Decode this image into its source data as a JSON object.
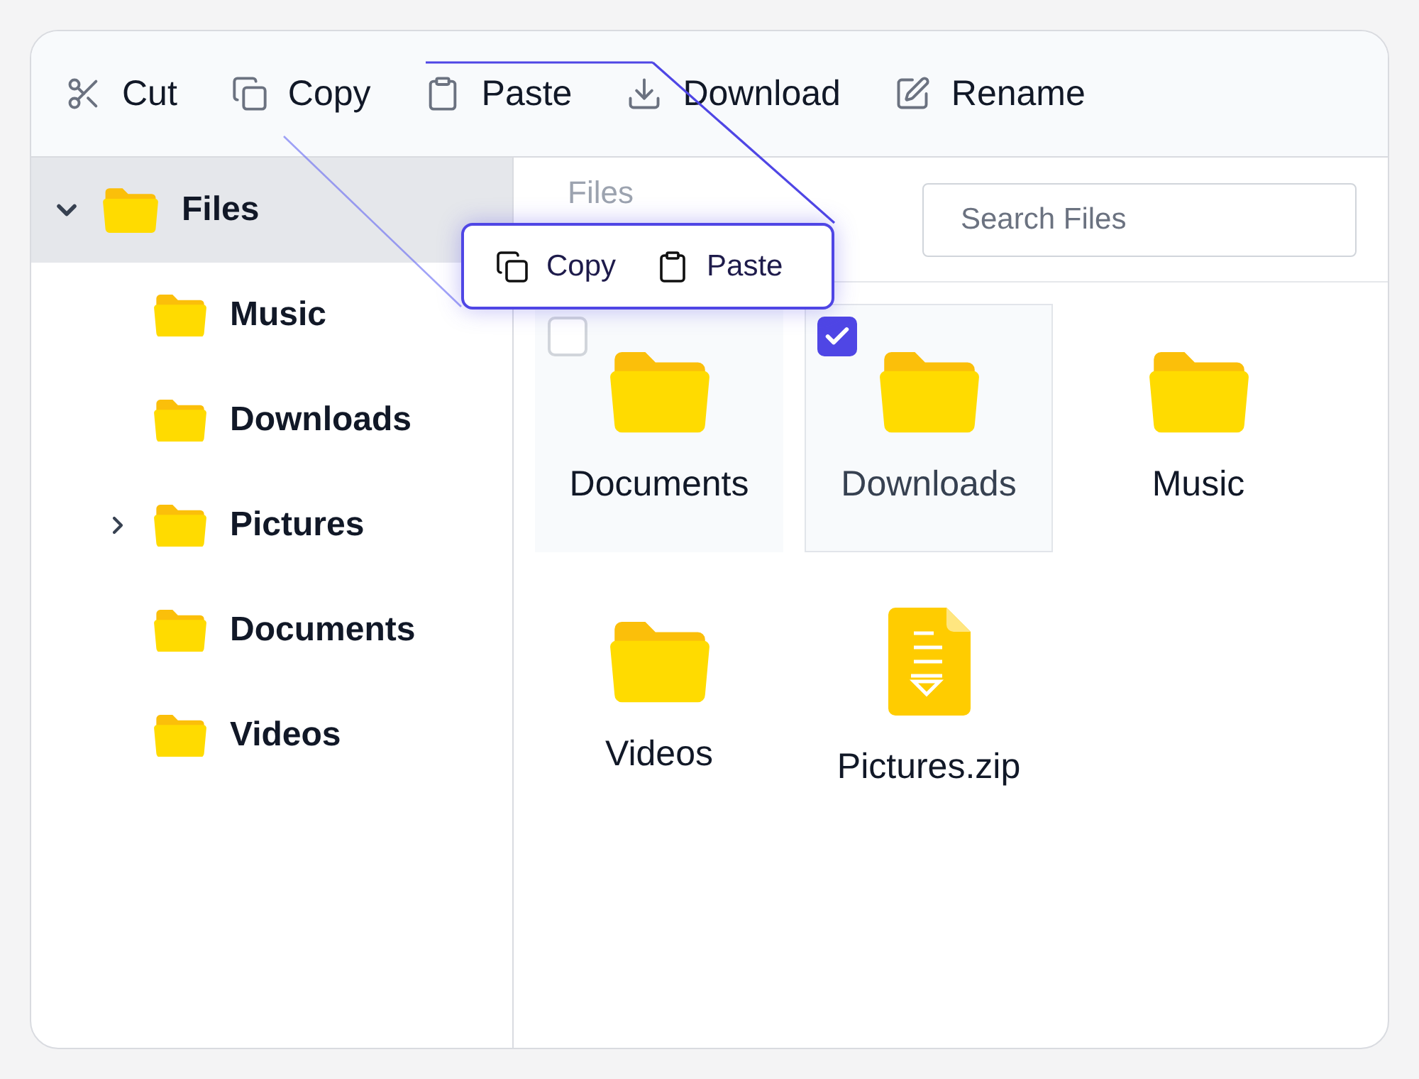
{
  "toolbar": [
    {
      "kind": "cut",
      "label": "Cut"
    },
    {
      "kind": "copy",
      "label": "Copy"
    },
    {
      "kind": "paste",
      "label": "Paste"
    },
    {
      "kind": "download",
      "label": "Download"
    },
    {
      "kind": "rename",
      "label": "Rename"
    }
  ],
  "sidebar": {
    "items": [
      {
        "label": "Files",
        "expanded": true,
        "selected": true,
        "children": [
          {
            "label": "Music",
            "selected": false
          },
          {
            "label": "Downloads",
            "selected": false
          },
          {
            "label": "Pictures",
            "expanded": false,
            "selected": false
          },
          {
            "label": "Documents",
            "selected": false
          },
          {
            "label": "Videos",
            "selected": false
          }
        ]
      }
    ]
  },
  "breadcrumb": "Files",
  "search": {
    "placeholder": "Search Files"
  },
  "popup": [
    {
      "kind": "copy",
      "label": "Copy"
    },
    {
      "kind": "paste",
      "label": "Paste"
    }
  ],
  "items": [
    {
      "kind": "folder",
      "label": "Documents",
      "hovered": true,
      "selected": false
    },
    {
      "kind": "folder",
      "label": "Downloads",
      "hovered": false,
      "selected": true
    },
    {
      "kind": "folder",
      "label": "Music",
      "hovered": false,
      "selected": false
    },
    {
      "kind": "folder",
      "label": "Videos",
      "hovered": false,
      "selected": false
    },
    {
      "kind": "zip",
      "label": "Pictures.zip",
      "hovered": false,
      "selected": false
    }
  ]
}
